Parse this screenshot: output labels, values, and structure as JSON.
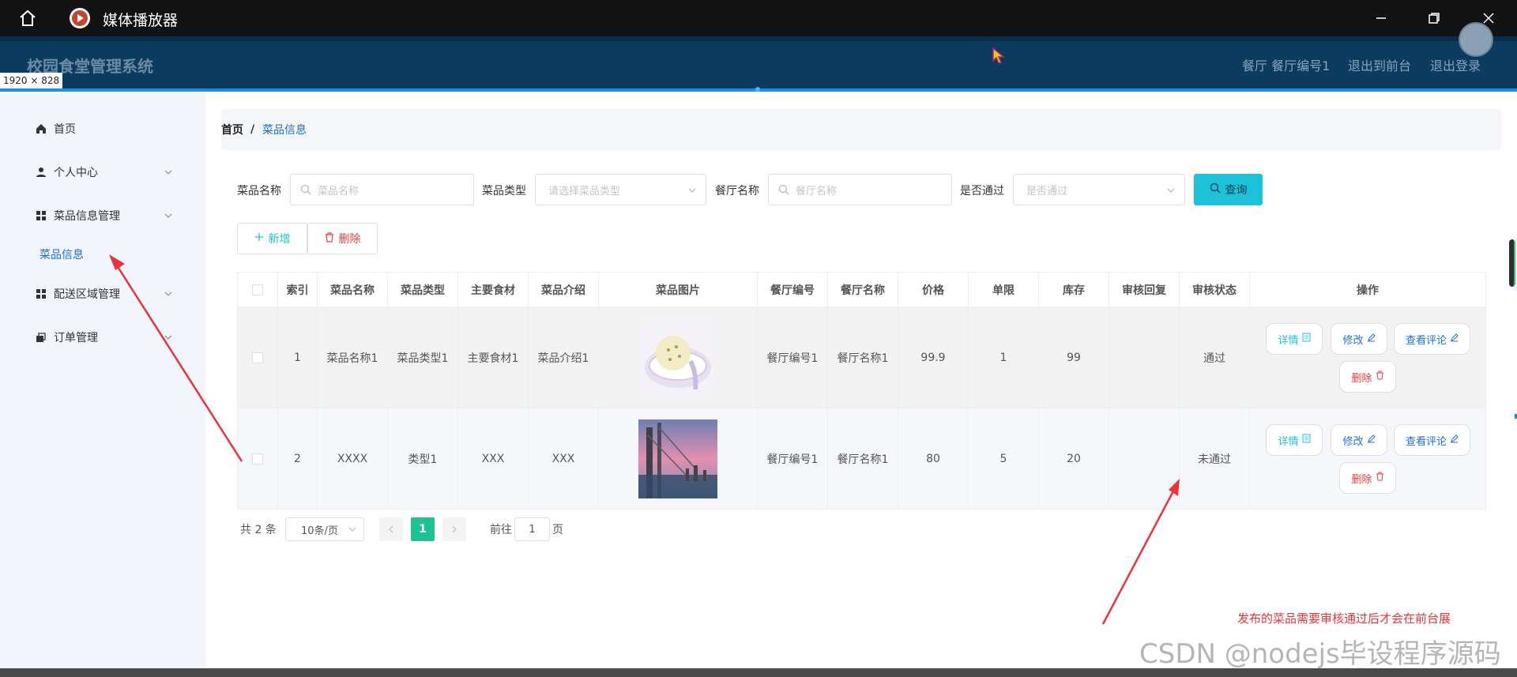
{
  "window": {
    "title": "媒体播放器",
    "size_label": "1920 × 828"
  },
  "header": {
    "app_title": "校园食堂管理系统",
    "user_label": "餐厅 餐厅编号1",
    "to_front_label": "退出到前台",
    "logout_label": "退出登录"
  },
  "sidebar": {
    "items": [
      {
        "label": "首页",
        "icon": "home-icon"
      },
      {
        "label": "个人中心",
        "icon": "user-icon"
      },
      {
        "label": "菜品信息管理",
        "icon": "grid-icon"
      },
      {
        "label": "配送区域管理",
        "icon": "grid-icon"
      },
      {
        "label": "订单管理",
        "icon": "cart-icon"
      }
    ],
    "active_sub": "菜品信息"
  },
  "breadcrumb": {
    "home": "首页",
    "separator": "/",
    "current": "菜品信息"
  },
  "filters": {
    "dish_name_label": "菜品名称",
    "dish_name_placeholder": "菜品名称",
    "dish_type_label": "菜品类型",
    "dish_type_placeholder": "请选择菜品类型",
    "restaurant_name_label": "餐厅名称",
    "restaurant_name_placeholder": "餐厅名称",
    "approved_label": "是否通过",
    "approved_placeholder": "是否通过",
    "query_button": "查询"
  },
  "toolbar": {
    "add_label": "新增",
    "delete_label": "删除"
  },
  "table": {
    "headers": [
      "",
      "索引",
      "菜品名称",
      "菜品类型",
      "主要食材",
      "菜品介绍",
      "菜品图片",
      "餐厅编号",
      "餐厅名称",
      "价格",
      "单限",
      "库存",
      "审核回复",
      "审核状态",
      "操作"
    ],
    "rows": [
      {
        "index": "1",
        "name": "菜品名称1",
        "type": "菜品类型1",
        "ingredients": "主要食材1",
        "intro": "菜品介绍1",
        "restaurant_no": "餐厅编号1",
        "restaurant_name": "餐厅名称1",
        "price": "99.9",
        "limit": "1",
        "stock": "99",
        "reply": "",
        "status": "通过"
      },
      {
        "index": "2",
        "name": "XXXX",
        "type": "类型1",
        "ingredients": "XXX",
        "intro": "XXX",
        "restaurant_no": "餐厅编号1",
        "restaurant_name": "餐厅名称1",
        "price": "80",
        "limit": "5",
        "stock": "20",
        "reply": "",
        "status": "未通过"
      }
    ],
    "ops": {
      "detail": "详情",
      "edit": "修改",
      "review": "查看评论",
      "delete": "删除"
    }
  },
  "pagination": {
    "total": "共 2 条",
    "page_size": "10条/页",
    "current": "1",
    "goto_label": "前往",
    "goto_value": "1",
    "page_suffix": "页"
  },
  "annotation": {
    "text": "发布的菜品需要审核通过后才会在前台展"
  },
  "watermark": "CSDN @nodejs毕设程序源码",
  "colors": {
    "header_bg": "#0c3b60",
    "accent": "#1ec2d8",
    "active_page": "#1cc291",
    "danger": "#e53f3f",
    "link": "#1e6fd0"
  }
}
